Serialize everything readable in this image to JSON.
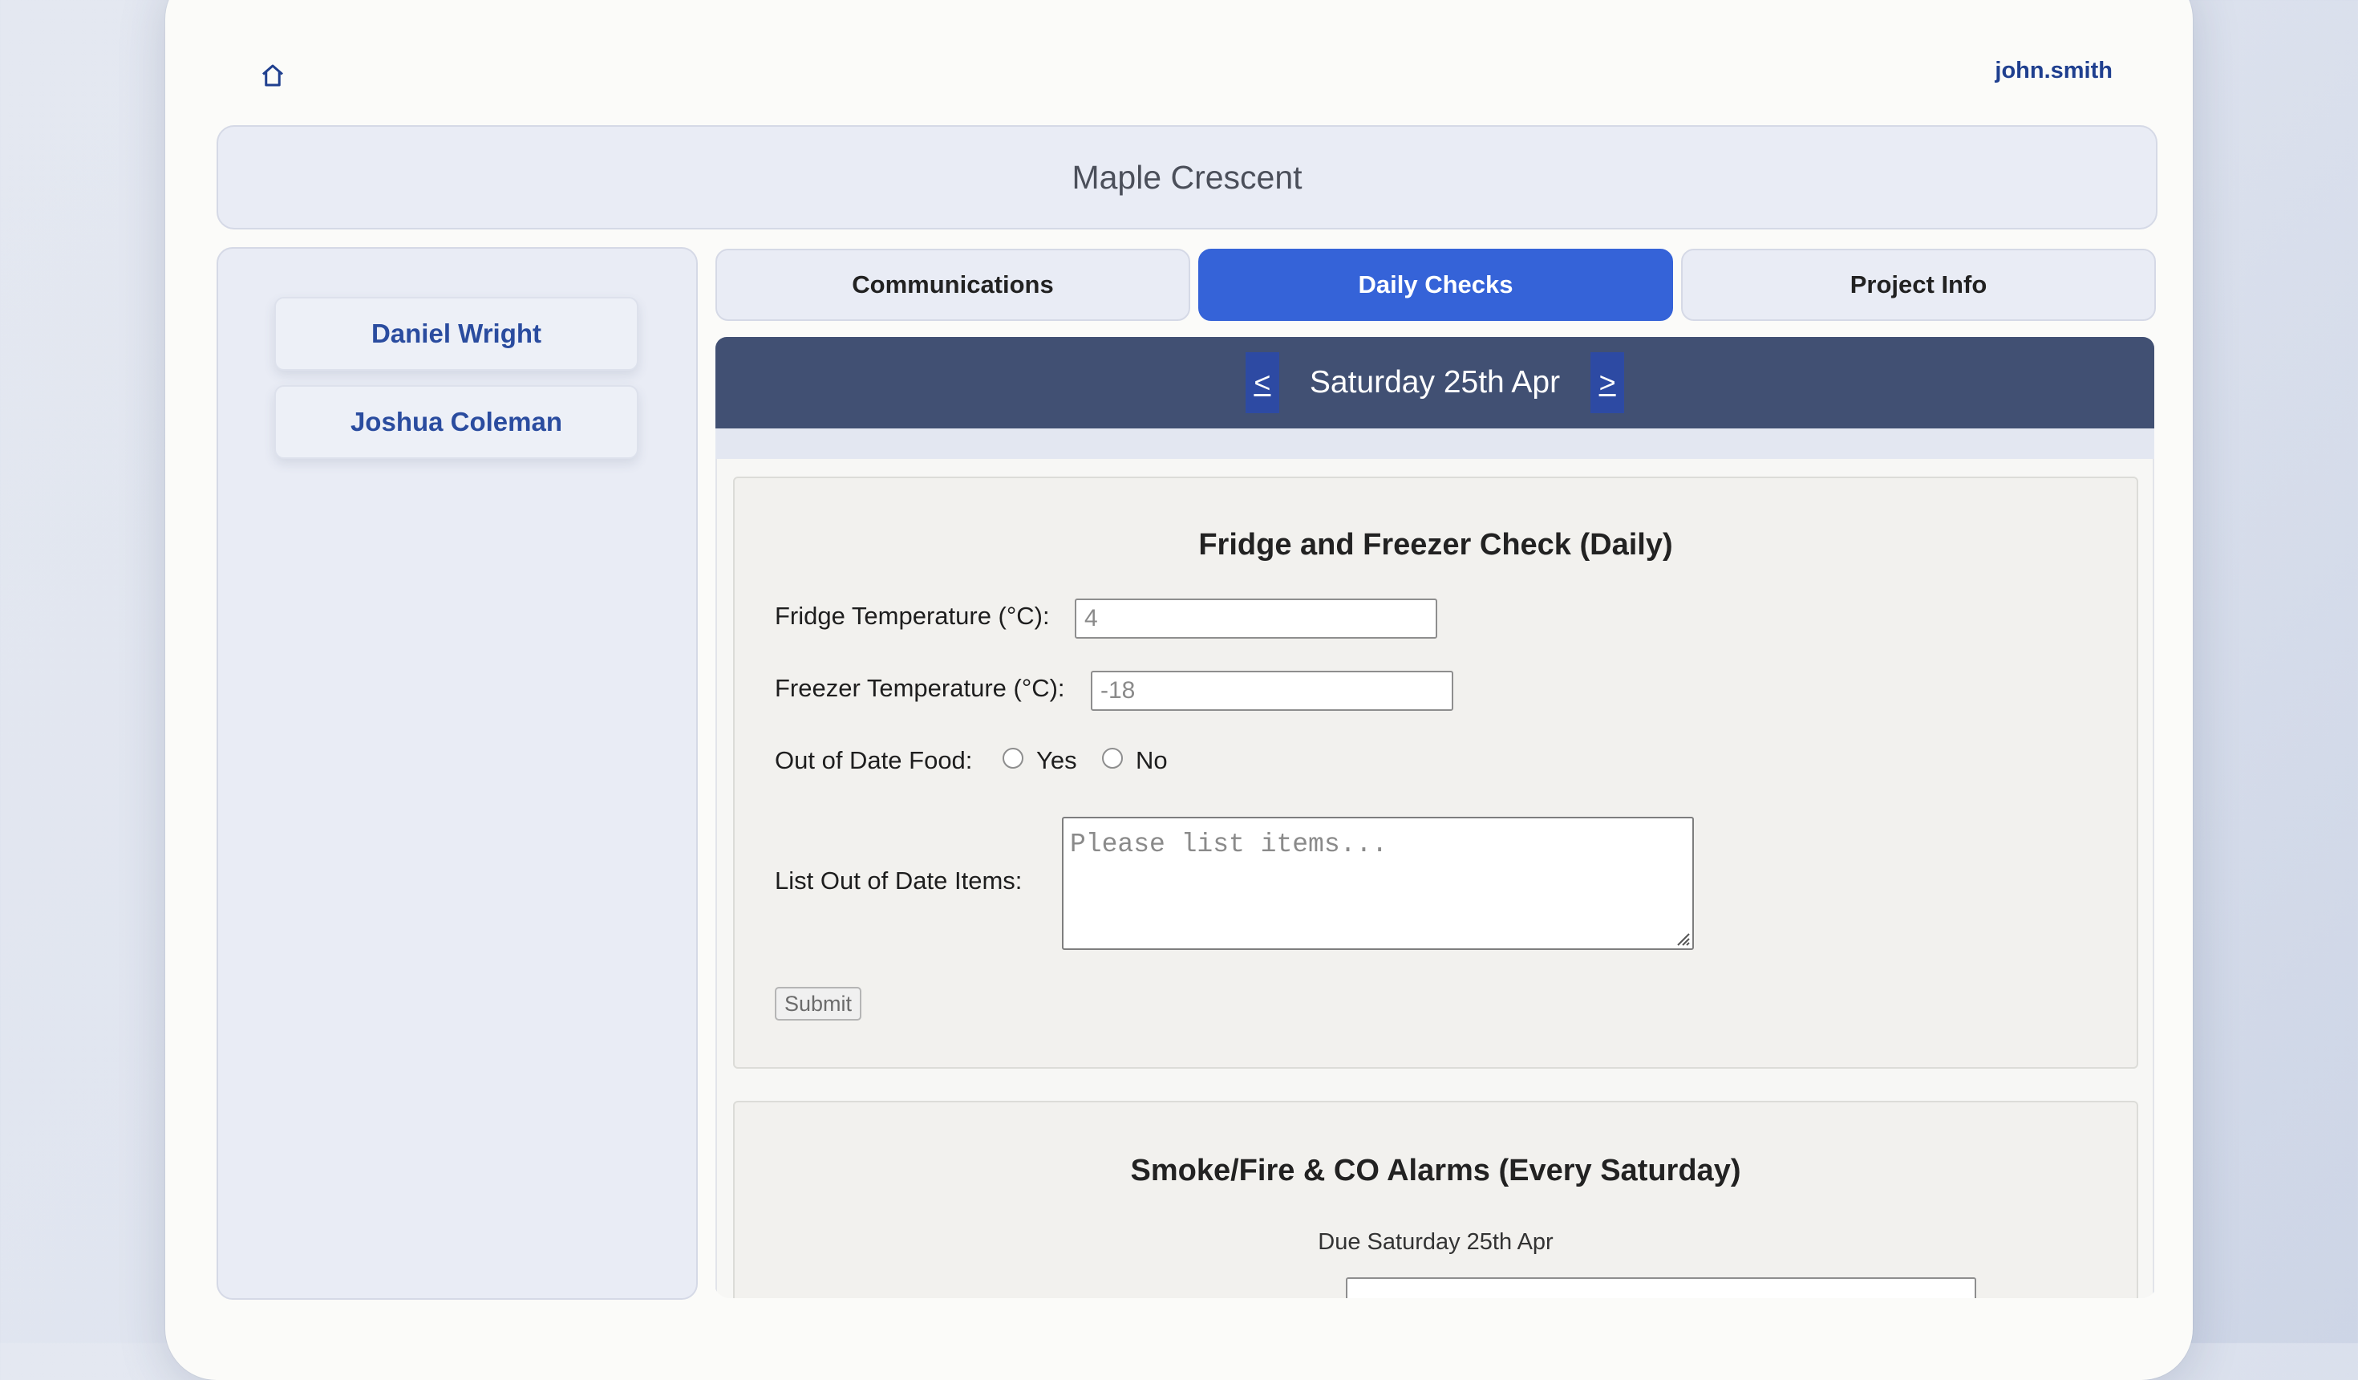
{
  "header": {
    "home_icon": "home-icon",
    "username": "john.smith"
  },
  "organization": {
    "name": "Maple Crescent"
  },
  "sidebar": {
    "people": [
      {
        "name": "Daniel Wright"
      },
      {
        "name": "Joshua Coleman"
      }
    ]
  },
  "tabs": [
    {
      "label": "Communications",
      "active": false
    },
    {
      "label": "Daily Checks",
      "active": true
    },
    {
      "label": "Project Info",
      "active": false
    }
  ],
  "date_nav": {
    "prev_label": "<",
    "date": "Saturday 25th Apr",
    "next_label": ">"
  },
  "fridge_check": {
    "title": "Fridge and Freezer Check (Daily)",
    "fridge_label": "Fridge Temperature (°C):",
    "fridge_placeholder": "4",
    "freezer_label": "Freezer Temperature (°C):",
    "freezer_placeholder": "-18",
    "out_of_date_label": "Out of Date Food:",
    "option_yes": "Yes",
    "option_no": "No",
    "list_label": "List Out of Date Items:",
    "list_placeholder": "Please list items...",
    "submit_label": "Submit"
  },
  "alarm_check": {
    "title": "Smoke/Fire & CO Alarms (Every Saturday)",
    "due_text": "Due Saturday 25th Apr"
  },
  "colors": {
    "accent": "#3563d8",
    "date_bar": "#415073",
    "link": "#1f3f8f"
  }
}
